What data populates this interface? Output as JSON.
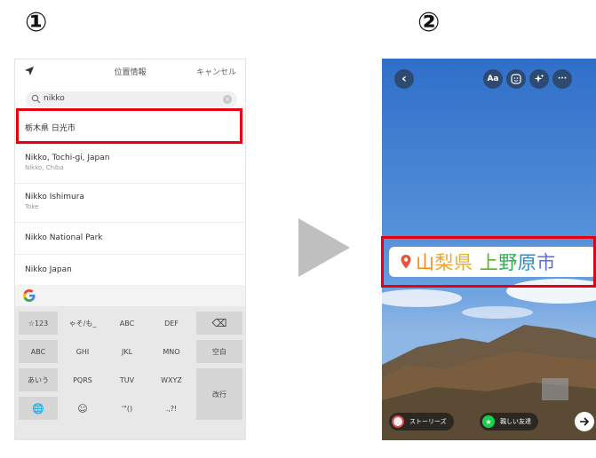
{
  "steps": {
    "step1": "①",
    "step2": "②"
  },
  "phone1": {
    "title": "位置情報",
    "cancel_label": "キャンセル",
    "search": {
      "value": "nikko"
    },
    "results": [
      {
        "title": "栃木県 日光市",
        "subtitle": ""
      },
      {
        "title": "Nikko, Tochi-ɡi, Japan",
        "subtitle": "Nikko, Chiba"
      },
      {
        "title": "Nikko Ishimura",
        "subtitle": "Toke"
      },
      {
        "title": "Nikko National Park",
        "subtitle": ""
      },
      {
        "title": "Nikko Japan",
        "subtitle": ""
      }
    ],
    "keyboard": {
      "rows": [
        [
          "☆123",
          "ゃそ/も_",
          "ABC",
          "DEF",
          "⌫"
        ],
        [
          "ABC",
          "GHI",
          "JKL",
          "MNO",
          "空白"
        ],
        [
          "あいう",
          "PQRS",
          "TUV",
          "WXYZ",
          "改行"
        ],
        [
          "🌐",
          "☺",
          "'\"()",
          ".,?!",
          ""
        ]
      ]
    }
  },
  "phone2": {
    "location_tag": {
      "chars": [
        {
          "text": "山",
          "color": "#f08a1c"
        },
        {
          "text": "梨",
          "color": "#f4a32a"
        },
        {
          "text": "県",
          "color": "#e9b31e"
        },
        {
          "text": " ",
          "color": "#000000"
        },
        {
          "text": "上",
          "color": "#5bb12d"
        },
        {
          "text": "野",
          "color": "#2fae52"
        },
        {
          "text": "原",
          "color": "#2a8ec8"
        },
        {
          "text": "市",
          "color": "#5b6cd8"
        }
      ],
      "pin_color": "#e8543a"
    },
    "toolbar": {
      "back": "‹",
      "text_tool": "Aa",
      "more": "···"
    },
    "bottom": {
      "story_label": "ストーリーズ",
      "friends_label": "親しい友達"
    }
  },
  "colors": {
    "highlight": "#e60012",
    "friends_green": "#1bd14b"
  }
}
